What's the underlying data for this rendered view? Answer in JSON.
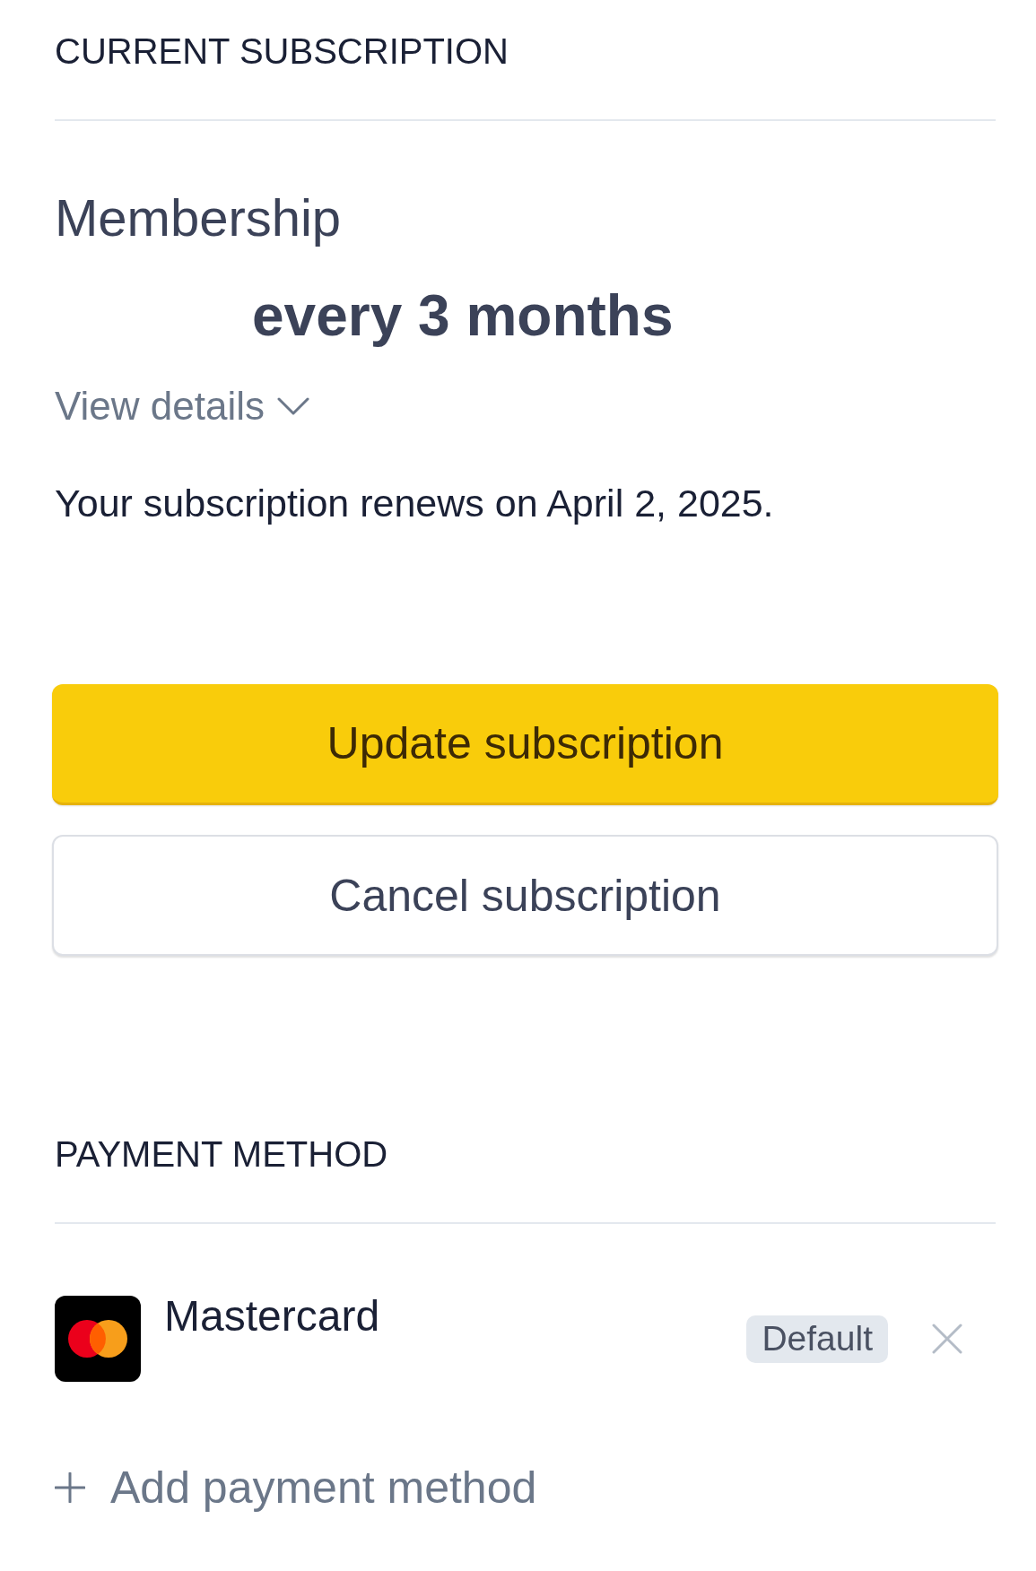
{
  "current_subscription": {
    "heading": "CURRENT SUBSCRIPTION",
    "plan_name": "Membership",
    "billing_interval": "every 3 months",
    "details_toggle": {
      "label": "View details",
      "expanded": false
    },
    "renewal_notice": "Your subscription renews on April 2, 2025.",
    "buttons": [
      {
        "label": "Update subscription",
        "kind": "primary"
      },
      {
        "label": "Cancel subscription",
        "kind": "secondary"
      }
    ]
  },
  "payment_method": {
    "heading": "PAYMENT METHOD",
    "cards": [
      {
        "name": "Mastercard",
        "default": true,
        "badge": "Default"
      }
    ],
    "add_button": {
      "label": "Add payment method"
    }
  }
}
